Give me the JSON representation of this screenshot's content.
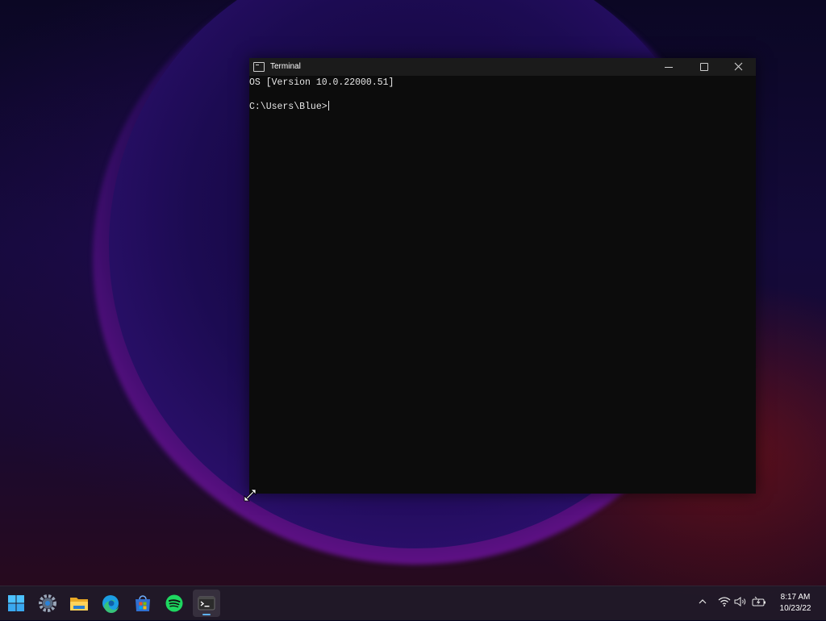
{
  "window": {
    "title": "Terminal",
    "console_lines": [
      "OS [Version 10.0.22000.51]",
      "C:\\Users\\Blue>"
    ]
  },
  "taskbar": {
    "apps": [
      {
        "name": "start",
        "icon": "windows-logo-icon"
      },
      {
        "name": "settings",
        "icon": "gear-icon"
      },
      {
        "name": "file-explorer",
        "icon": "folder-icon"
      },
      {
        "name": "edge",
        "icon": "edge-browser-icon"
      },
      {
        "name": "microsoft-store",
        "icon": "store-icon"
      },
      {
        "name": "spotify",
        "icon": "spotify-icon"
      },
      {
        "name": "terminal",
        "icon": "terminal-icon",
        "active": true
      }
    ],
    "tray": [
      "chevron-up-icon",
      "wifi-icon",
      "volume-icon",
      "battery-icon"
    ],
    "clock": {
      "time": "8:17 AM",
      "date": "10/23/22"
    }
  },
  "colors": {
    "accent": "#5fb2f2",
    "terminal_bg": "#0c0c0c",
    "titlebar_bg": "#1b1b1b"
  }
}
